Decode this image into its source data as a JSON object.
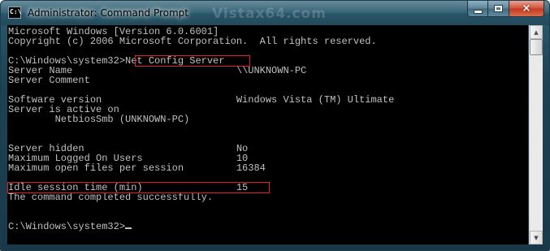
{
  "window": {
    "title": "Administrator: Command Prompt",
    "icon_text": "C:\\",
    "watermark": "Vistax64.com",
    "controls": {
      "minimize": "minimize-icon",
      "maximize": "maximize-icon",
      "close": "×"
    }
  },
  "console": {
    "lines": [
      "Microsoft Windows [Version 6.0.6001]",
      "Copyright (c) 2006 Microsoft Corporation.  All rights reserved.",
      "",
      "C:\\Windows\\system32>Net Config Server",
      "Server Name                            \\\\UNKNOWN-PC",
      "Server Comment",
      "",
      "Software version                       Windows Vista (TM) Ultimate",
      "Server is active on",
      "        NetbiosSmb (UNKNOWN-PC)",
      "",
      "",
      "Server hidden                          No",
      "Maximum Logged On Users                10",
      "Maximum open files per session         16384",
      "",
      "Idle session time (min)                15",
      "The command completed successfully.",
      "",
      "",
      "C:\\Windows\\system32>"
    ]
  }
}
